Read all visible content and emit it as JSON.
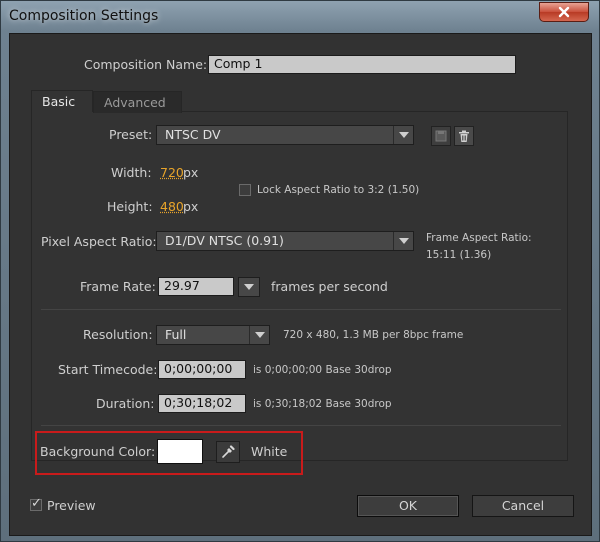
{
  "window": {
    "title": "Composition Settings"
  },
  "composition": {
    "name_label": "Composition Name:",
    "name_value": "Comp 1"
  },
  "tabs": [
    {
      "label": "Basic"
    },
    {
      "label": "Advanced"
    }
  ],
  "preset": {
    "label": "Preset:",
    "value": "NTSC DV"
  },
  "width": {
    "label": "Width:",
    "value": "720",
    "unit": "px"
  },
  "height": {
    "label": "Height:",
    "value": "480",
    "unit": "px"
  },
  "lock_aspect": {
    "label": "Lock Aspect Ratio to 3:2 (1.50)"
  },
  "pixel_aspect": {
    "label": "Pixel Aspect Ratio:",
    "value": "D1/DV NTSC (0.91)",
    "frame_aspect_label": "Frame Aspect Ratio:",
    "frame_aspect_value": "15:11 (1.36)"
  },
  "frame_rate": {
    "label": "Frame Rate:",
    "value": "29.97",
    "unit": "frames per second"
  },
  "resolution": {
    "label": "Resolution:",
    "value": "Full",
    "info": "720 x 480, 1.3 MB per 8bpc frame"
  },
  "start_timecode": {
    "label": "Start Timecode:",
    "value": "0;00;00;00",
    "info": "is 0;00;00;00  Base 30drop"
  },
  "duration": {
    "label": "Duration:",
    "value": "0;30;18;02",
    "info": "is 0;30;18;02  Base 30drop"
  },
  "background": {
    "label": "Background Color:",
    "color": "#ffffff",
    "name": "White"
  },
  "footer": {
    "preview_label": "Preview",
    "ok_label": "OK",
    "cancel_label": "Cancel"
  }
}
